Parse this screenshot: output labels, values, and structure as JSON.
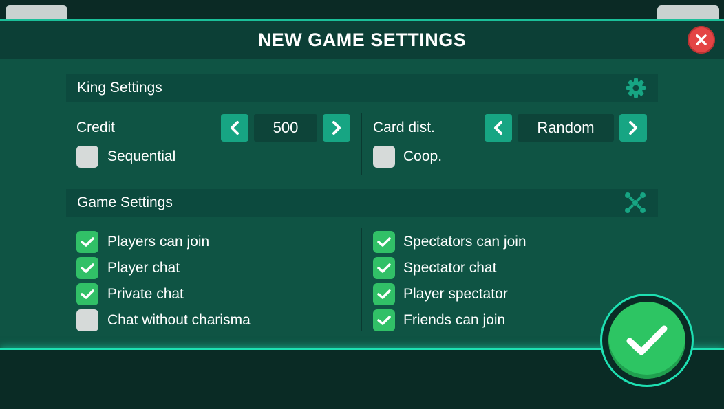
{
  "dialog": {
    "title": "NEW GAME SETTINGS",
    "close_icon": "close-icon"
  },
  "king_settings": {
    "header": "King Settings",
    "header_icon": "gear-icon",
    "credit_label": "Credit",
    "credit_value": "500",
    "card_dist_label": "Card dist.",
    "card_dist_value": "Random",
    "sequential_label": "Sequential",
    "sequential_checked": false,
    "coop_label": "Coop.",
    "coop_checked": false
  },
  "game_settings": {
    "header": "Game Settings",
    "header_icon": "players-icon",
    "left": [
      {
        "label": "Players can join",
        "checked": true
      },
      {
        "label": "Player chat",
        "checked": true
      },
      {
        "label": "Private chat",
        "checked": true
      },
      {
        "label": "Chat without charisma",
        "checked": false
      }
    ],
    "right": [
      {
        "label": "Spectators can join",
        "checked": true
      },
      {
        "label": "Spectator chat",
        "checked": true
      },
      {
        "label": "Player spectator",
        "checked": true
      },
      {
        "label": "Friends can join",
        "checked": true
      }
    ]
  },
  "confirm": {
    "icon": "checkmark-icon"
  },
  "colors": {
    "panel": "#0f5444",
    "accent": "#1ee0b2",
    "check_on": "#31c067",
    "close": "#e44545"
  }
}
